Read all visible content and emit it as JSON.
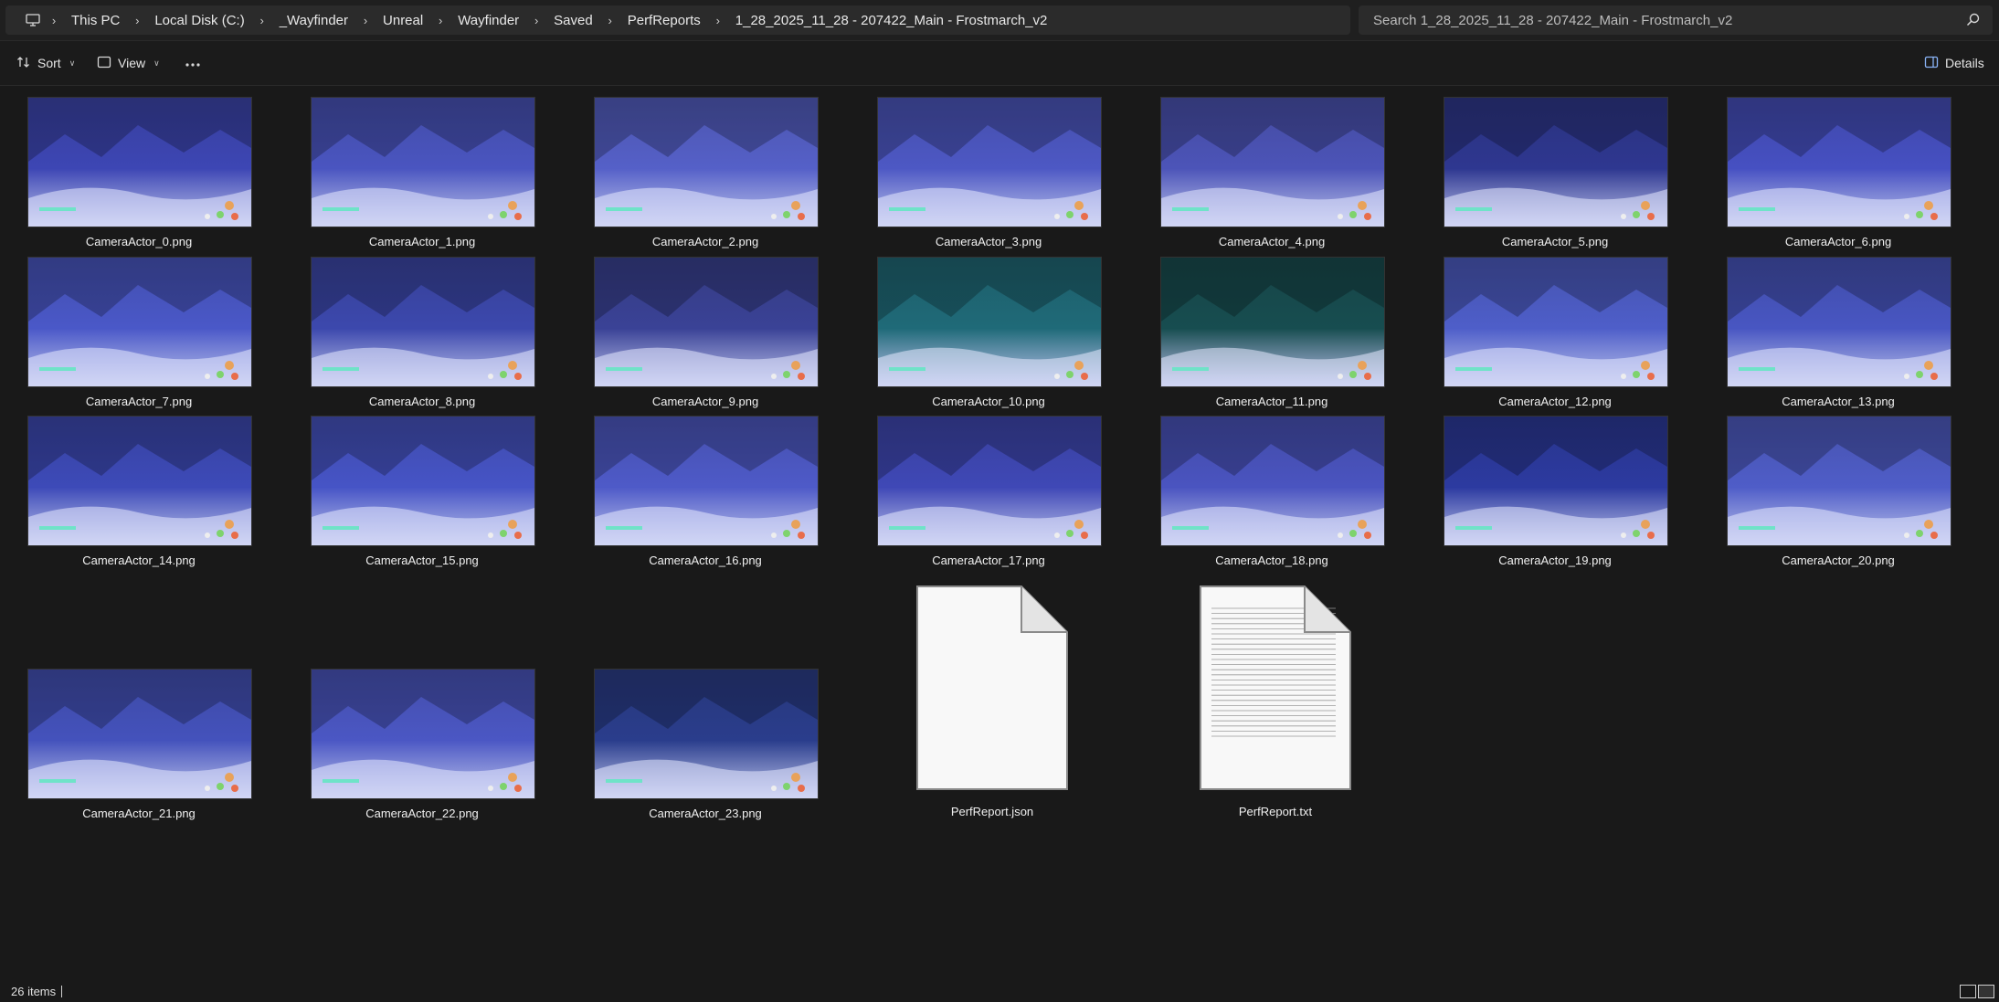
{
  "breadcrumb": {
    "items": [
      "This PC",
      "Local Disk (C:)",
      "_Wayfinder",
      "Unreal",
      "Wayfinder",
      "Saved",
      "PerfReports",
      "1_28_2025_11_28 - 207422_Main - Frostmarch_v2"
    ]
  },
  "search": {
    "placeholder": "Search 1_28_2025_11_28 - 207422_Main - Frostmarch_v2"
  },
  "toolbar": {
    "sort_label": "Sort",
    "view_label": "View",
    "details_label": "Details"
  },
  "files": [
    {
      "name": "CameraActor_0.png",
      "type": "image",
      "tone": "#3d46b4"
    },
    {
      "name": "CameraActor_1.png",
      "type": "image",
      "tone": "#4a55c0"
    },
    {
      "name": "CameraActor_2.png",
      "type": "image",
      "tone": "#5560c8"
    },
    {
      "name": "CameraActor_3.png",
      "type": "image",
      "tone": "#4d58c4"
    },
    {
      "name": "CameraActor_4.png",
      "type": "image",
      "tone": "#4c54b8"
    },
    {
      "name": "CameraActor_5.png",
      "type": "image",
      "tone": "#2e3790"
    },
    {
      "name": "CameraActor_6.png",
      "type": "image",
      "tone": "#4650c2"
    },
    {
      "name": "CameraActor_7.png",
      "type": "image",
      "tone": "#4a58c8"
    },
    {
      "name": "CameraActor_8.png",
      "type": "image",
      "tone": "#3c48ad"
    },
    {
      "name": "CameraActor_9.png",
      "type": "image",
      "tone": "#3a4296"
    },
    {
      "name": "CameraActor_10.png",
      "type": "image",
      "tone": "#1f6a78"
    },
    {
      "name": "CameraActor_11.png",
      "type": "image",
      "tone": "#174d50"
    },
    {
      "name": "CameraActor_12.png",
      "type": "image",
      "tone": "#4e5ec9"
    },
    {
      "name": "CameraActor_13.png",
      "type": "image",
      "tone": "#4856c2"
    },
    {
      "name": "CameraActor_14.png",
      "type": "image",
      "tone": "#3d4ab8"
    },
    {
      "name": "CameraActor_15.png",
      "type": "image",
      "tone": "#4654c6"
    },
    {
      "name": "CameraActor_16.png",
      "type": "image",
      "tone": "#4e5ac8"
    },
    {
      "name": "CameraActor_17.png",
      "type": "image",
      "tone": "#3f48b6"
    },
    {
      "name": "CameraActor_18.png",
      "type": "image",
      "tone": "#4a54c0"
    },
    {
      "name": "CameraActor_19.png",
      "type": "image",
      "tone": "#2c3aa0"
    },
    {
      "name": "CameraActor_20.png",
      "type": "image",
      "tone": "#4f5dc8"
    },
    {
      "name": "CameraActor_21.png",
      "type": "image",
      "tone": "#4452bc"
    },
    {
      "name": "CameraActor_22.png",
      "type": "image",
      "tone": "#4b57c4"
    },
    {
      "name": "CameraActor_23.png",
      "type": "image",
      "tone": "#2a3d8c"
    },
    {
      "name": "PerfReport.json",
      "type": "json"
    },
    {
      "name": "PerfReport.txt",
      "type": "text"
    }
  ],
  "status": {
    "item_count": "26 items"
  }
}
